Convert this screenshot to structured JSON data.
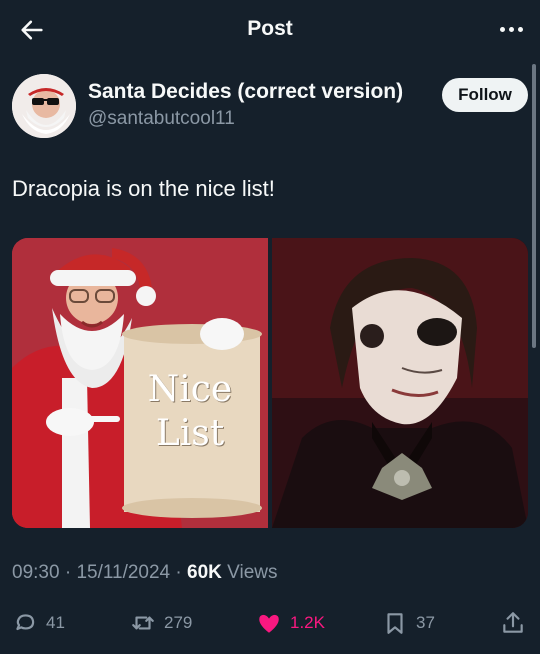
{
  "header": {
    "title": "Post",
    "back_icon": "arrow-left-icon",
    "more_icon": "more-horizontal-icon"
  },
  "author": {
    "display_name": "Santa Decides (correct version)",
    "handle": "@santabutcool11",
    "follow_label": "Follow"
  },
  "tweet": {
    "text": "Dracopia is on the nice list!"
  },
  "media": {
    "left": {
      "sign_line1": "Nice",
      "sign_line2": "List"
    },
    "right": {}
  },
  "meta": {
    "time": "09:30",
    "sep1": " · ",
    "date": "15/11/2024",
    "sep2": " · ",
    "views_count": "60K",
    "views_label": " Views"
  },
  "actions": {
    "replies": "41",
    "reposts": "279",
    "likes": "1.2K",
    "bookmarks": "37"
  },
  "colors": {
    "background": "#15202b",
    "like": "#f91880",
    "muted": "#8b98a5"
  }
}
